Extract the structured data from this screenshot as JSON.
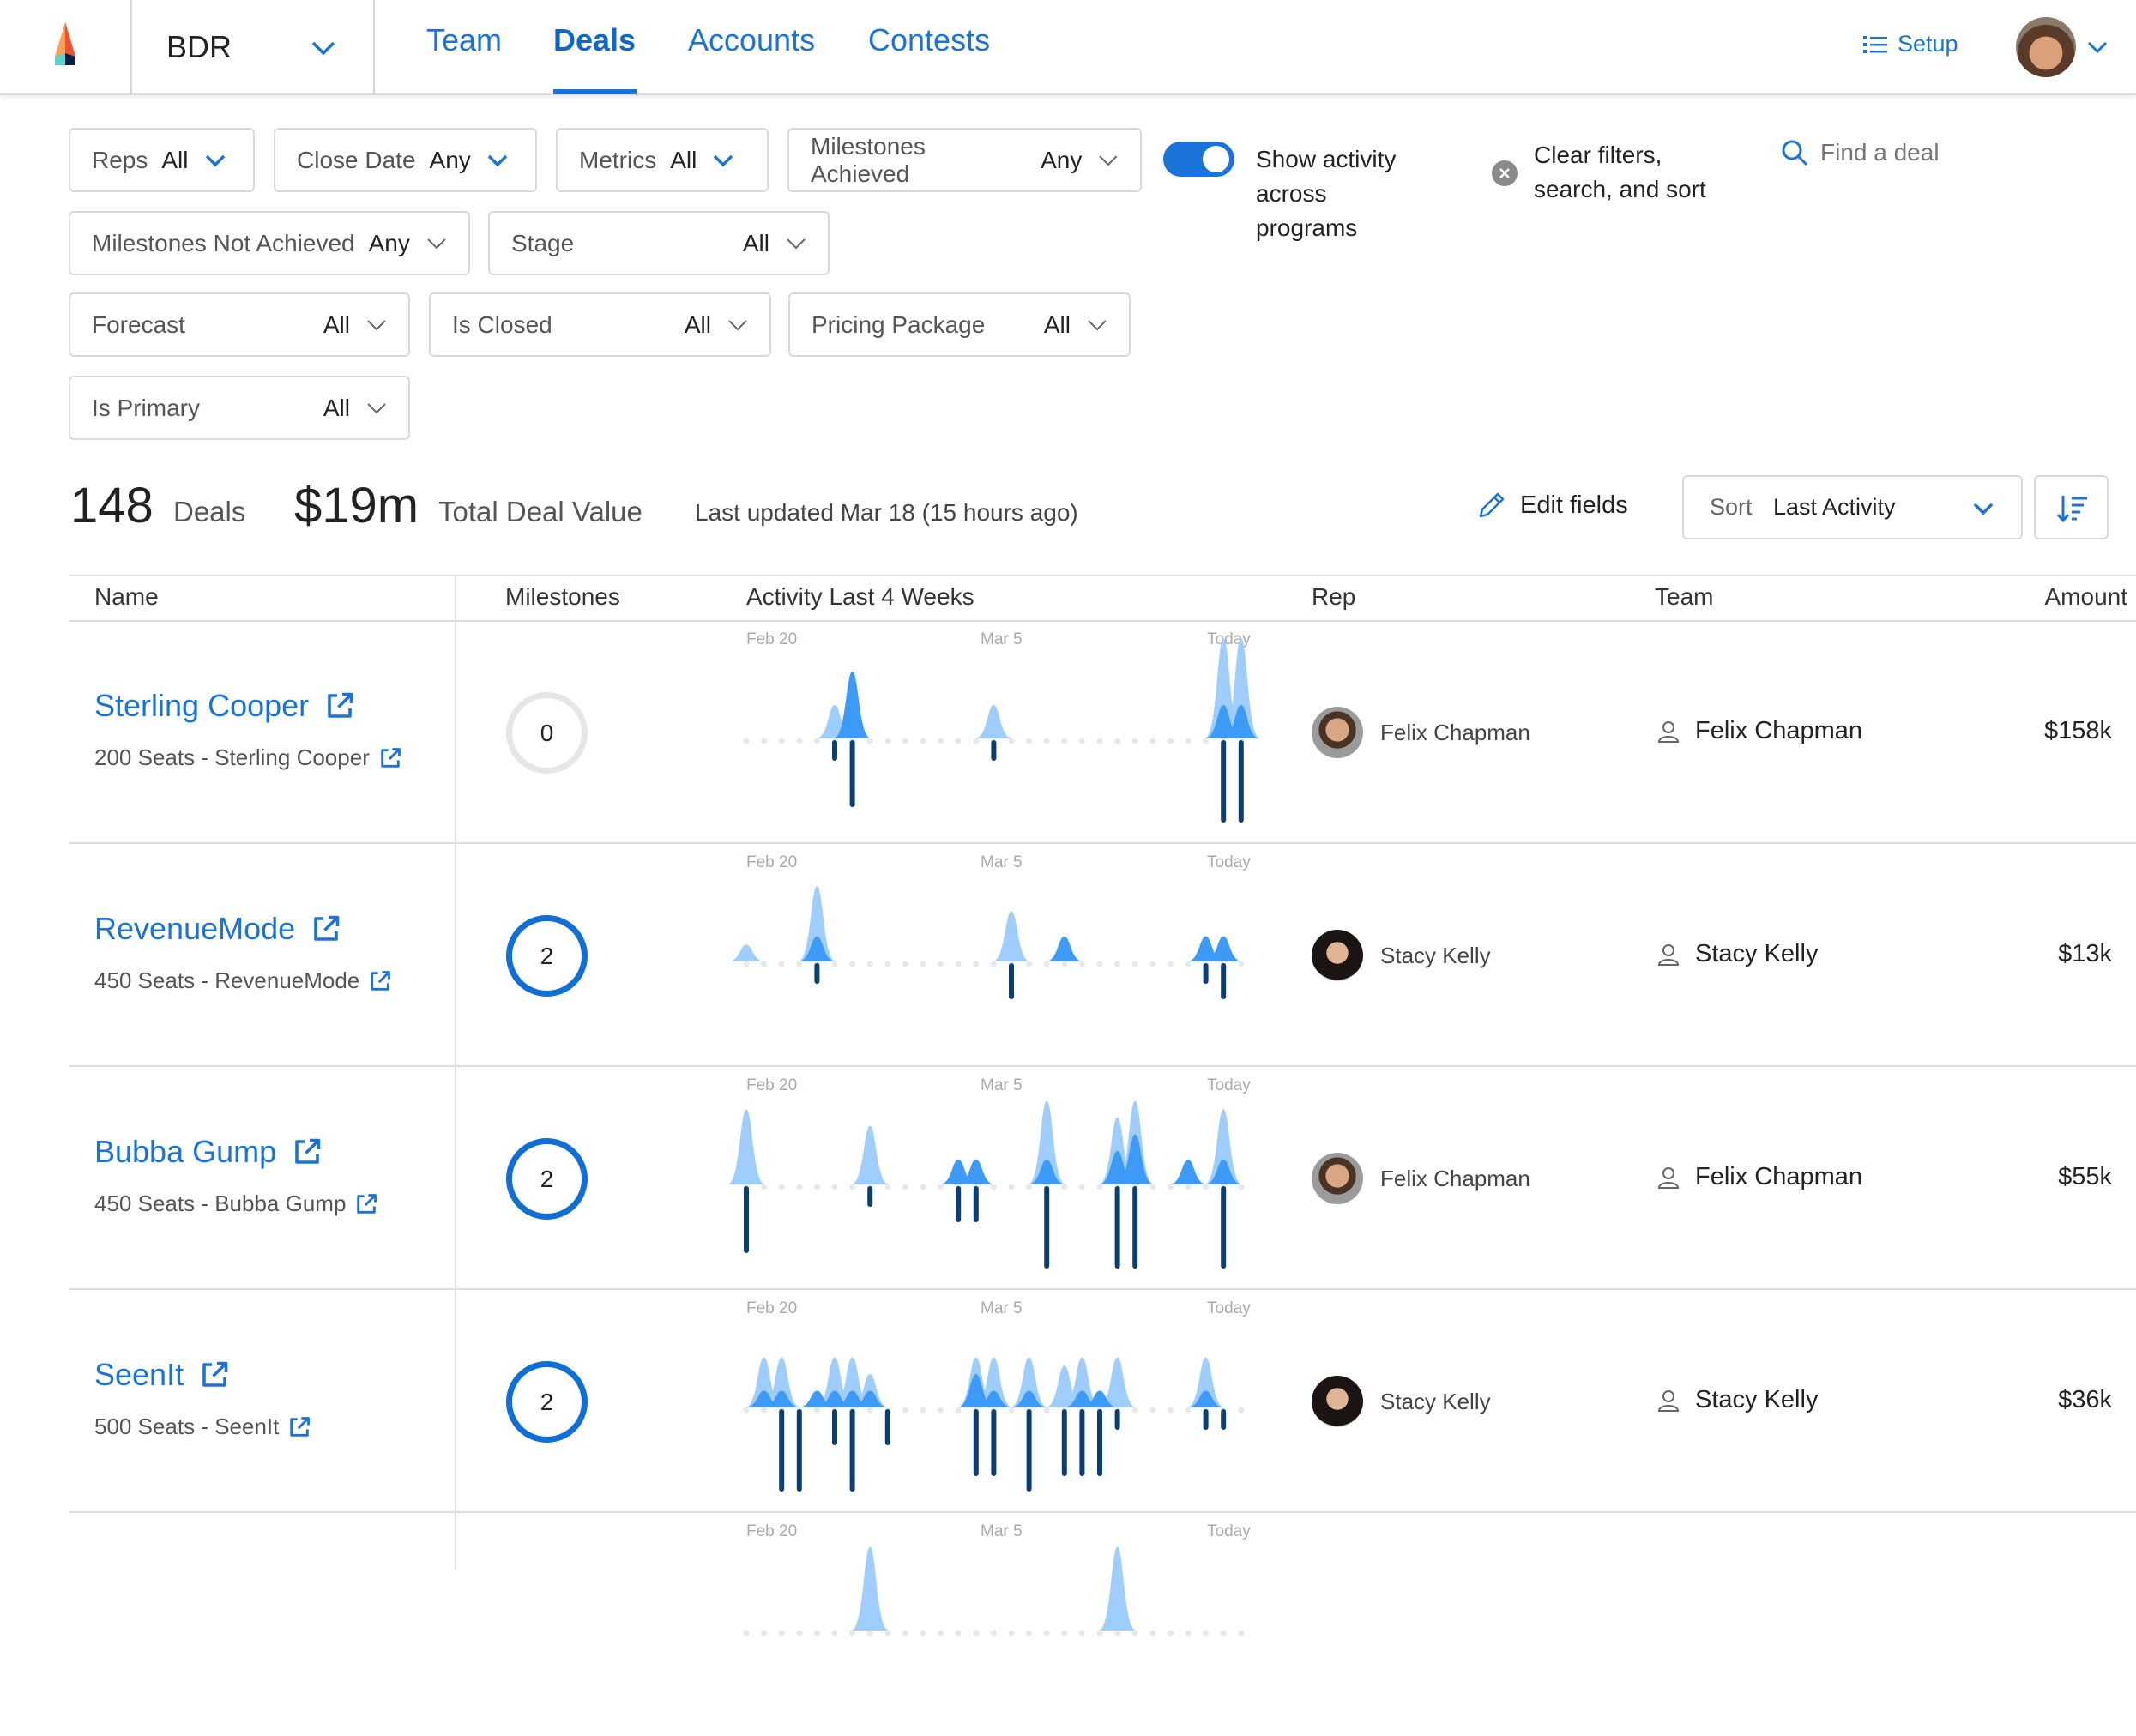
{
  "nav": {
    "team_selector": "BDR",
    "tabs": [
      {
        "label": "Team",
        "active": false
      },
      {
        "label": "Deals",
        "active": true
      },
      {
        "label": "Accounts",
        "active": false
      },
      {
        "label": "Contests",
        "active": false
      }
    ],
    "setup_label": "Setup",
    "accent": "#1a73d9"
  },
  "filters": [
    {
      "label": "Reps",
      "value": "All"
    },
    {
      "label": "Close Date",
      "value": "Any"
    },
    {
      "label": "Metrics",
      "value": "All"
    },
    {
      "label": "Milestones Achieved",
      "value": "Any"
    },
    {
      "label": "Milestones Not Achieved",
      "value": "Any"
    },
    {
      "label": "Stage",
      "value": "All"
    },
    {
      "label": "Forecast",
      "value": "All"
    },
    {
      "label": "Is Closed",
      "value": "All"
    },
    {
      "label": "Pricing Package",
      "value": "All"
    },
    {
      "label": "Is Primary",
      "value": "All"
    }
  ],
  "toggle": {
    "label_lines": [
      "Show activity",
      "across",
      "programs"
    ],
    "on": true
  },
  "clear": {
    "label_lines": [
      "Clear filters,",
      "search, and sort"
    ]
  },
  "search": {
    "placeholder": "Find a deal"
  },
  "summary": {
    "deal_count": "148",
    "deal_label": "Deals",
    "total_value": "$19m",
    "total_label": "Total Deal Value",
    "last_updated": "Last updated Mar 18 (15 hours ago)"
  },
  "toolbar": {
    "edit_fields": "Edit fields",
    "sort_label": "Sort",
    "sort_value": "Last Activity"
  },
  "table": {
    "columns": [
      "Name",
      "Milestones",
      "Activity Last 4 Weeks",
      "Rep",
      "Team",
      "Amount"
    ],
    "date_labels": [
      "Feb 20",
      "Mar 5",
      "Today"
    ],
    "colors": {
      "light": "#9fcdfd",
      "dark": "#3d9bf7",
      "bars": "#0b3e73",
      "dots": "#e8e8e8"
    },
    "rows": [
      {
        "name": "Sterling Cooper",
        "subtitle": "200 Seats - Sterling Cooper",
        "milestones": "0",
        "rep": "Felix Chapman",
        "team": "Felix Chapman",
        "amount": "$158k",
        "activity": {
          "light": [
            [
              5,
              2
            ],
            [
              6,
              4
            ],
            [
              14,
              2
            ],
            [
              27,
              6
            ],
            [
              28,
              6
            ]
          ],
          "dark": [
            [
              6,
              4
            ],
            [
              27,
              2
            ],
            [
              28,
              2
            ]
          ],
          "bars": [
            [
              5,
              1
            ],
            [
              6,
              4
            ],
            [
              14,
              1
            ],
            [
              27,
              5
            ],
            [
              28,
              5
            ]
          ]
        }
      },
      {
        "name": "RevenueMode",
        "subtitle": "450 Seats - RevenueMode",
        "milestones": "2",
        "rep": "Stacy Kelly",
        "team": "Stacy Kelly",
        "amount": "$13k",
        "activity": {
          "light": [
            [
              0,
              1
            ],
            [
              4,
              4.5
            ],
            [
              15,
              3
            ],
            [
              26,
              1.5
            ],
            [
              27,
              1.5
            ]
          ],
          "dark": [
            [
              4,
              1.5
            ],
            [
              18,
              1.5
            ],
            [
              26,
              1.5
            ],
            [
              27,
              1.5
            ]
          ],
          "bars": [
            [
              4,
              1
            ],
            [
              15,
              2
            ],
            [
              26,
              1
            ],
            [
              27,
              2
            ]
          ]
        }
      },
      {
        "name": "Bubba Gump",
        "subtitle": "450 Seats - Bubba Gump",
        "milestones": "2",
        "rep": "Felix Chapman",
        "team": "Felix Chapman",
        "amount": "$55k",
        "activity": {
          "light": [
            [
              0,
              4.5
            ],
            [
              7,
              3.5
            ],
            [
              12,
              1.5
            ],
            [
              13,
              1.5
            ],
            [
              17,
              5
            ],
            [
              21,
              4
            ],
            [
              22,
              5
            ],
            [
              27,
              4.5
            ]
          ],
          "dark": [
            [
              12,
              1.5
            ],
            [
              13,
              1.5
            ],
            [
              17,
              1.5
            ],
            [
              21,
              2
            ],
            [
              22,
              3
            ],
            [
              25,
              1.5
            ],
            [
              27,
              1.5
            ]
          ],
          "bars": [
            [
              0,
              4
            ],
            [
              7,
              1
            ],
            [
              12,
              2
            ],
            [
              13,
              2
            ],
            [
              17,
              5
            ],
            [
              21,
              5
            ],
            [
              22,
              5
            ],
            [
              27,
              5
            ]
          ]
        }
      },
      {
        "name": "SeenIt",
        "subtitle": "500 Seats - SeenIt",
        "milestones": "2",
        "rep": "Stacy Kelly",
        "team": "Stacy Kelly",
        "amount": "$36k",
        "activity": {
          "light": [
            [
              1,
              3
            ],
            [
              2,
              3
            ],
            [
              5,
              3
            ],
            [
              6,
              3
            ],
            [
              7,
              2
            ],
            [
              13,
              3
            ],
            [
              14,
              3
            ],
            [
              16,
              3
            ],
            [
              18,
              2.5
            ],
            [
              19,
              3
            ],
            [
              21,
              3
            ],
            [
              26,
              3
            ]
          ],
          "dark": [
            [
              1,
              1
            ],
            [
              2,
              1
            ],
            [
              4,
              1
            ],
            [
              5,
              1
            ],
            [
              6,
              1
            ],
            [
              7,
              1
            ],
            [
              13,
              2
            ],
            [
              14,
              1
            ],
            [
              16,
              1
            ],
            [
              19,
              1
            ],
            [
              20,
              1
            ],
            [
              26,
              1
            ]
          ],
          "bars": [
            [
              2,
              5
            ],
            [
              3,
              5
            ],
            [
              5,
              2
            ],
            [
              6,
              5
            ],
            [
              8,
              2
            ],
            [
              13,
              4
            ],
            [
              14,
              4
            ],
            [
              16,
              5
            ],
            [
              18,
              4
            ],
            [
              19,
              4
            ],
            [
              20,
              4
            ],
            [
              21,
              1
            ],
            [
              26,
              1
            ],
            [
              27,
              1
            ]
          ]
        }
      }
    ],
    "partial_row": {
      "activity": {
        "light": [
          [
            7,
            5
          ],
          [
            21,
            5
          ]
        ],
        "dark": [],
        "bars": []
      }
    }
  }
}
